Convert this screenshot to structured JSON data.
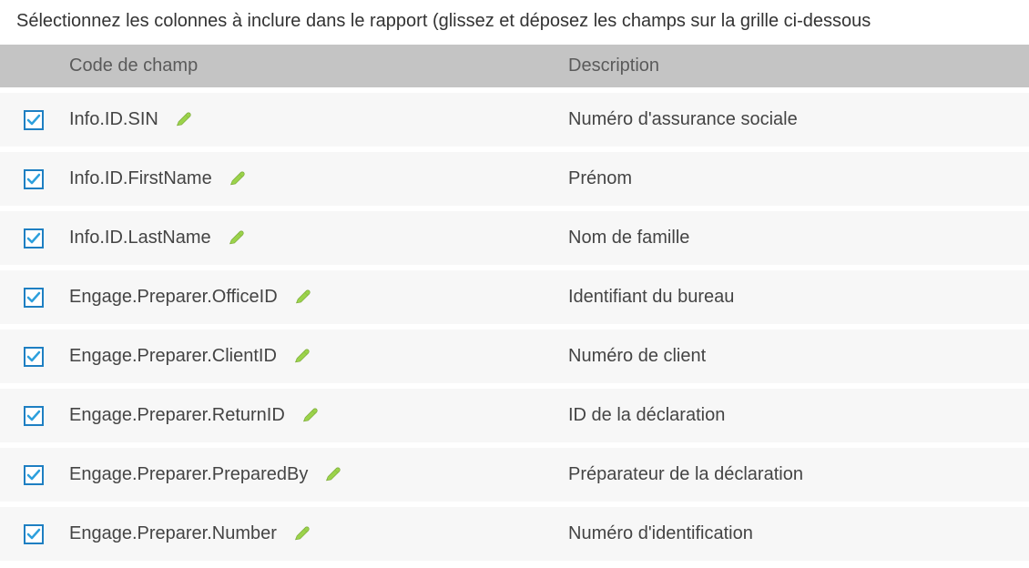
{
  "instructions": "Sélectionnez les colonnes à inclure dans le rapport (glissez et déposez les champs sur la grille ci-dessous",
  "headers": {
    "check": "",
    "code": "Code de champ",
    "description": "Description"
  },
  "rows": [
    {
      "checked": true,
      "code": "Info.ID.SIN",
      "description": "Numéro d'assurance sociale"
    },
    {
      "checked": true,
      "code": "Info.ID.FirstName",
      "description": "Prénom"
    },
    {
      "checked": true,
      "code": "Info.ID.LastName",
      "description": "Nom de famille"
    },
    {
      "checked": true,
      "code": "Engage.Preparer.OfficeID",
      "description": "Identifiant du bureau"
    },
    {
      "checked": true,
      "code": "Engage.Preparer.ClientID",
      "description": "Numéro de client"
    },
    {
      "checked": true,
      "code": "Engage.Preparer.ReturnID",
      "description": "ID de la déclaration"
    },
    {
      "checked": true,
      "code": "Engage.Preparer.PreparedBy",
      "description": "Préparateur de la déclaration"
    },
    {
      "checked": true,
      "code": "Engage.Preparer.Number",
      "description": "Numéro d'identification"
    }
  ]
}
